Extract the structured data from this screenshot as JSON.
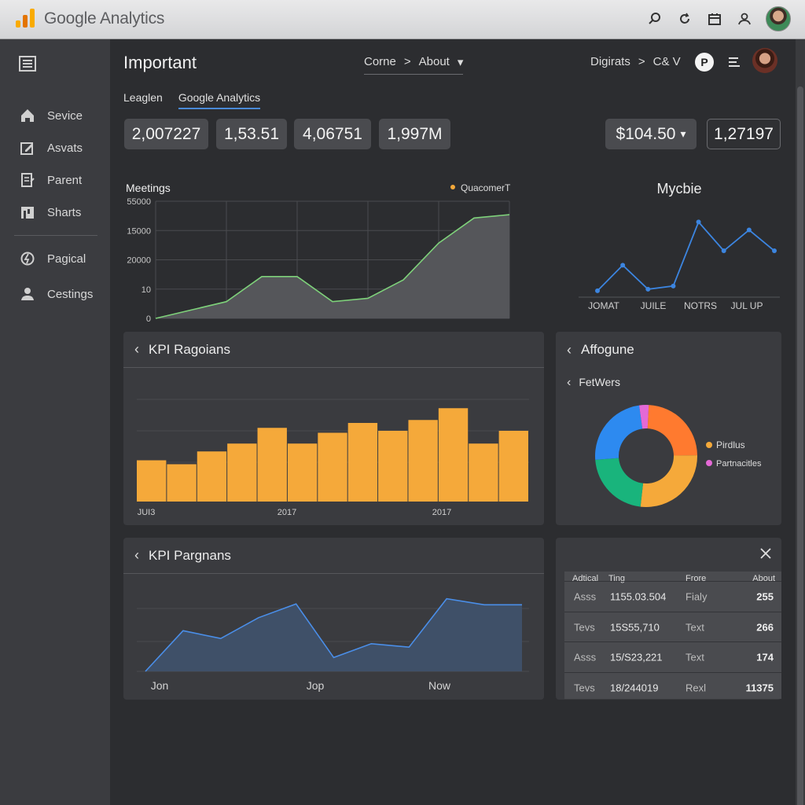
{
  "app": {
    "brand": "Google Analytics",
    "logo_colors": [
      "#f9ab00",
      "#e37400",
      "#f9ab00"
    ]
  },
  "topbar_icons": [
    "search-icon",
    "refresh-icon",
    "calendar-icon",
    "account-icon"
  ],
  "sidebar": {
    "items": [
      {
        "label": "Sevice",
        "icon": "home-icon"
      },
      {
        "label": "Asvats",
        "icon": "edit-icon"
      },
      {
        "label": "Parent",
        "icon": "document-icon"
      },
      {
        "label": "Sharts",
        "icon": "chart-icon"
      },
      {
        "label": "Pagical",
        "icon": "power-icon"
      },
      {
        "label": "Cestings",
        "icon": "person-icon"
      }
    ]
  },
  "header": {
    "title": "Important",
    "breadcrumb": [
      "Corne",
      ">",
      "About"
    ],
    "right_nav": [
      "Digirats",
      ">",
      "C& V"
    ],
    "badge": "P"
  },
  "tabs": [
    "Leaglen",
    "Google Analytics"
  ],
  "kpis": [
    "2,007227",
    "1,53.51",
    "4,06751",
    "1,997M"
  ],
  "price_selector": {
    "value": "$104.50"
  },
  "kpi_right": "1,27197",
  "colors": {
    "accent": "#4a8ad8",
    "bar": "#f5a93a",
    "line_green": "#7ed17a",
    "line_blue": "#3c85e0"
  },
  "chart_data": [
    {
      "type": "area",
      "title": "Meetings",
      "legend": [
        "QuacomerT"
      ],
      "legend_placement": "top-right",
      "y_ticks": [
        "55000",
        "15000",
        "20000",
        "10",
        "0"
      ],
      "values": [
        0,
        5,
        10,
        25,
        25,
        10,
        12,
        23,
        45,
        60,
        62
      ],
      "ylim": [
        0,
        70
      ],
      "grid": true
    },
    {
      "type": "line",
      "title": "Mycbie",
      "x_labels": [
        "JOMAT",
        "JUILE",
        "NOTRS",
        "JUL UP"
      ],
      "values": [
        2,
        18,
        3,
        5,
        45,
        27,
        40,
        27
      ],
      "ylim": [
        0,
        55
      ]
    },
    {
      "type": "bar",
      "title": "KPI Ragoians",
      "x_labels": [
        "JUI3",
        "2017",
        "2017"
      ],
      "values": [
        42,
        38,
        51,
        59,
        75,
        59,
        70,
        80,
        72,
        83,
        95,
        59,
        72
      ],
      "ylim": [
        0,
        120
      ],
      "grid": true
    },
    {
      "type": "pie",
      "title": "Affogune",
      "subtitle": "FetWers",
      "legend": [
        {
          "label": "Pirdlus",
          "color": "#f5a93a"
        },
        {
          "label": "Partnacitles",
          "color": "#e469d6"
        }
      ],
      "slices": [
        {
          "value": 24,
          "color": "#ff7a2f"
        },
        {
          "value": 27,
          "color": "#f5a93a"
        },
        {
          "value": 22,
          "color": "#19b47c"
        },
        {
          "value": 24,
          "color": "#2d8af0"
        },
        {
          "value": 3,
          "color": "#e469d6"
        }
      ]
    },
    {
      "type": "area",
      "title": "KPI Pargnans",
      "x_labels": [
        "Jon",
        "Jop",
        "Now"
      ],
      "values": [
        0,
        47,
        38,
        62,
        78,
        16,
        32,
        28,
        84,
        77,
        77
      ],
      "ylim": [
        0,
        100
      ],
      "grid": true
    }
  ],
  "table": {
    "headers": [
      "Adtical",
      "Ting",
      "Frore",
      "About"
    ],
    "rows": [
      [
        "Asss",
        "1155.03.504",
        "Fialy",
        "255"
      ],
      [
        "Tevs",
        "15S55,710",
        "Text",
        "266"
      ],
      [
        "Asss",
        "15/S23,221",
        "Text",
        "174"
      ],
      [
        "Tevs",
        "18/244019",
        "Rexl",
        "11375"
      ]
    ]
  }
}
